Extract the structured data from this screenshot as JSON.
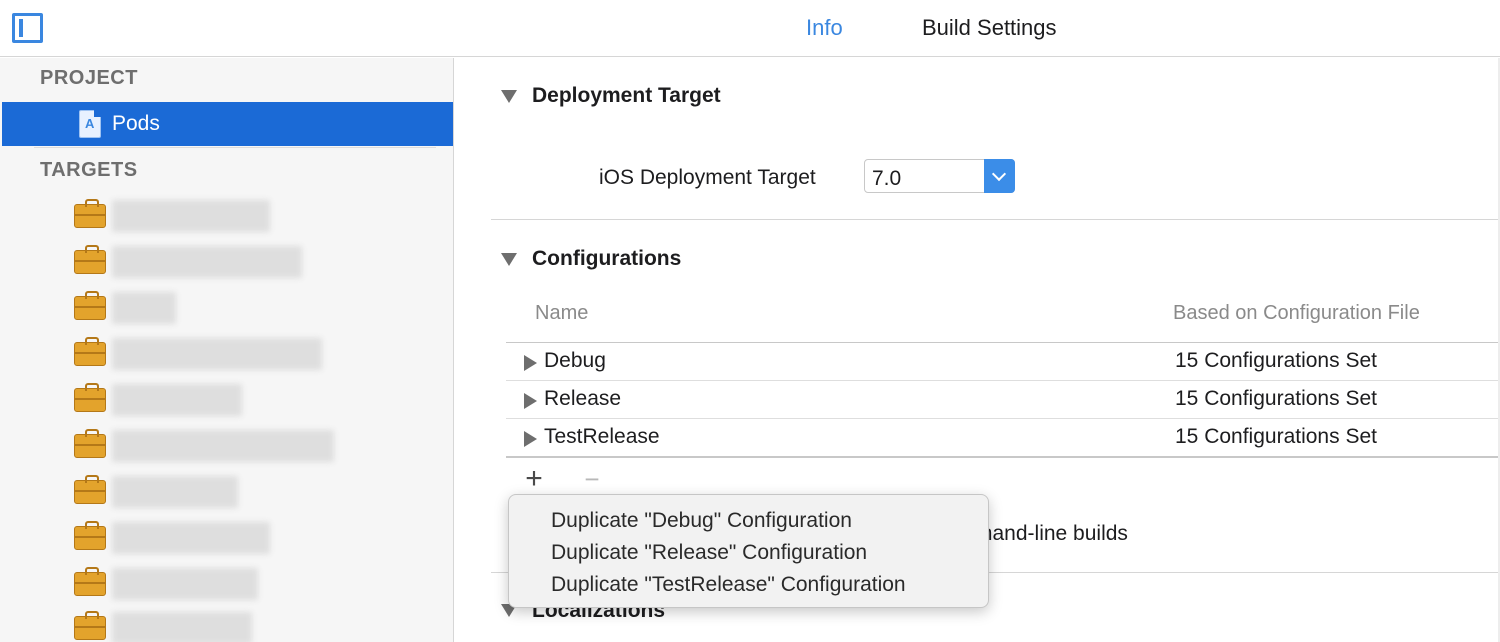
{
  "toolbar": {
    "sidebar_toggle_icon": "sidebar-toggle-icon",
    "tabs": [
      {
        "label": "Info",
        "selected": true
      },
      {
        "label": "Build Settings",
        "selected": false
      }
    ],
    "accent_color": "#3a87e0"
  },
  "sidebar": {
    "project_header": "PROJECT",
    "project_item": {
      "label": "Pods",
      "icon": "xcode-project-icon",
      "selected": true
    },
    "targets_header": "TARGETS",
    "targets": [
      {
        "icon": "target-toolbox-icon",
        "label_redacted": true
      },
      {
        "icon": "target-toolbox-icon",
        "label_redacted": true
      },
      {
        "icon": "target-toolbox-icon",
        "label_redacted": true
      },
      {
        "icon": "target-toolbox-icon",
        "label_redacted": true
      },
      {
        "icon": "target-toolbox-icon",
        "label_redacted": true
      },
      {
        "icon": "target-toolbox-icon",
        "label_redacted": true
      },
      {
        "icon": "target-toolbox-icon",
        "label_redacted": true
      },
      {
        "icon": "target-toolbox-icon",
        "label_redacted": true
      },
      {
        "icon": "target-toolbox-icon",
        "label_redacted": true
      },
      {
        "icon": "target-toolbox-icon",
        "label_redacted": true
      }
    ],
    "selection_color": "#1b6ad6"
  },
  "main": {
    "deployment_target": {
      "title": "Deployment Target",
      "field_label": "iOS Deployment Target",
      "selected_value": "7.0"
    },
    "configurations": {
      "title": "Configurations",
      "columns": [
        "Name",
        "Based on Configuration File"
      ],
      "rows": [
        {
          "name": "Debug",
          "based_on": "15 Configurations Set"
        },
        {
          "name": "Release",
          "based_on": "15 Configurations Set"
        },
        {
          "name": "TestRelease",
          "based_on": "15 Configurations Set"
        }
      ],
      "add_label": "+",
      "remove_label": "−",
      "partially_hidden_text": "mand-line builds"
    },
    "localizations": {
      "title": "Localizations"
    }
  },
  "popup_menu": {
    "items": [
      "Duplicate \"Debug\" Configuration",
      "Duplicate \"Release\" Configuration",
      "Duplicate \"TestRelease\" Configuration"
    ]
  }
}
